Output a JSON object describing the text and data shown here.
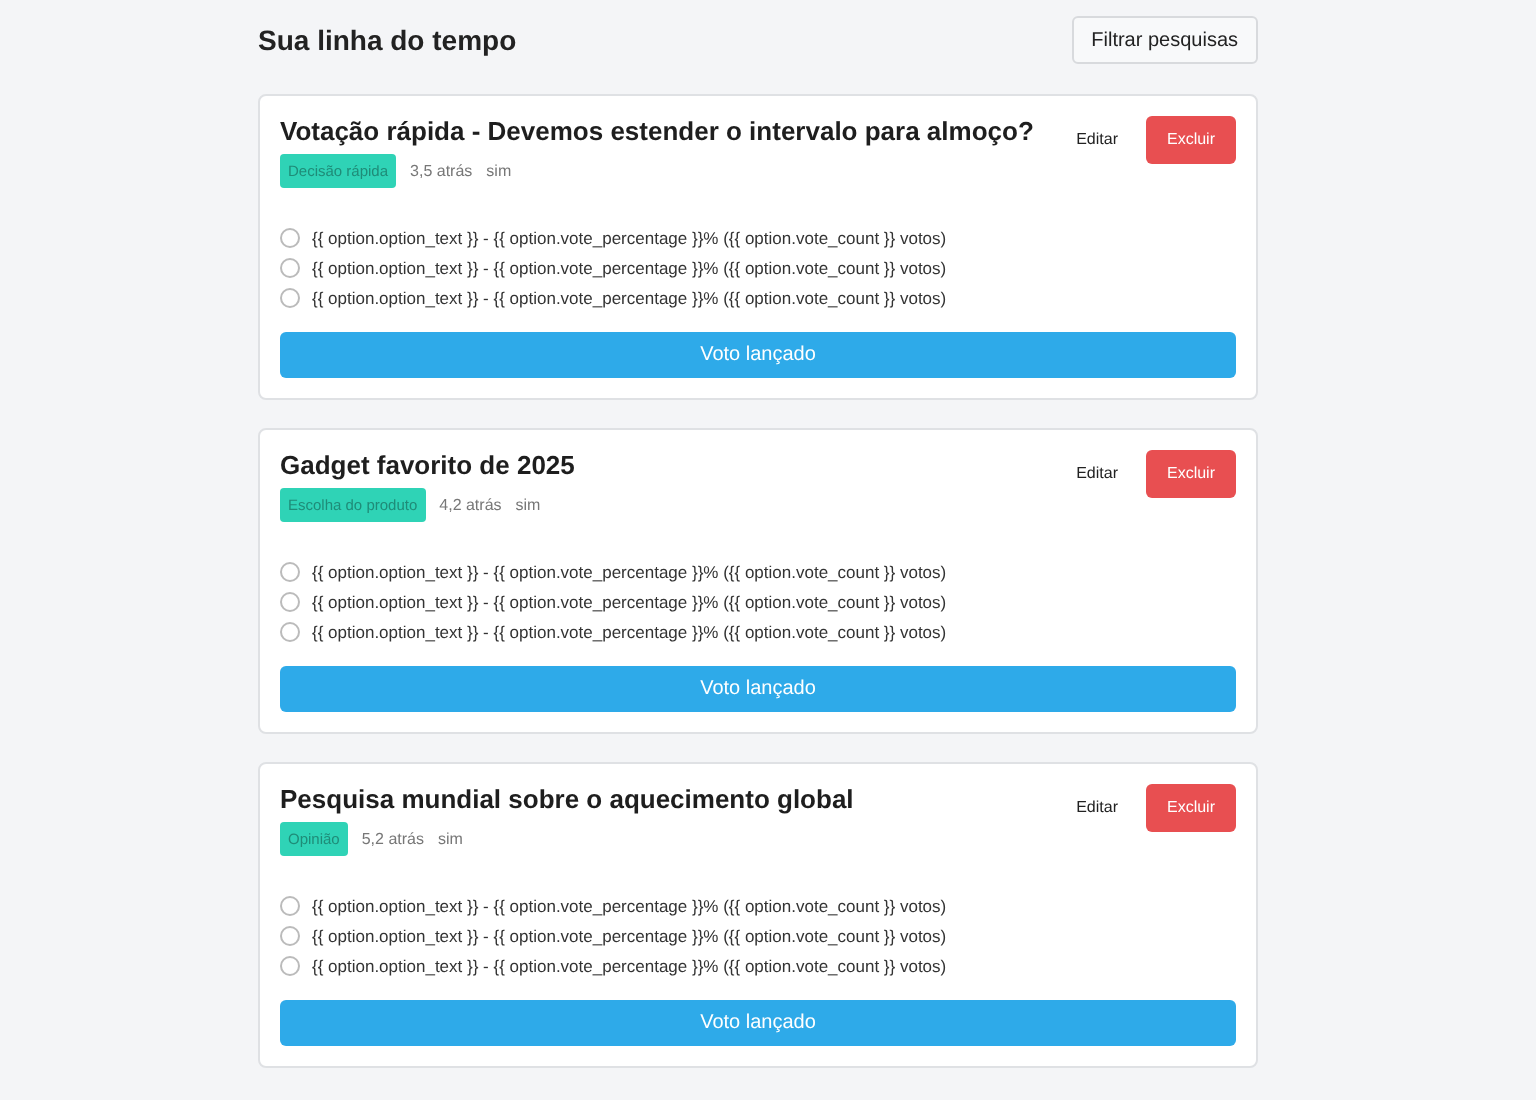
{
  "header": {
    "title": "Sua linha do tempo",
    "filter_button": "Filtrar pesquisas"
  },
  "polls": [
    {
      "title": "Votação rápida - Devemos estender o intervalo para almoço?",
      "tag": "Decisão rápida",
      "time": "3,5 atrás",
      "extra": "sim",
      "edit": "Editar",
      "delete": "Excluir",
      "options": [
        {
          "label": "{{ option.option_text }} - {{ option.vote_percentage }}% ({{ option.vote_count }} votos)",
          "selected": false
        },
        {
          "label": "{{ option.option_text }} - {{ option.vote_percentage }}% ({{ option.vote_count }} votos)",
          "selected": false
        },
        {
          "label": "{{ option.option_text }} - {{ option.vote_percentage }}% ({{ option.vote_count }} votos)",
          "selected": false
        }
      ],
      "vote_button": "Voto lançado"
    },
    {
      "title": "Gadget favorito de 2025",
      "tag": "Escolha do produto",
      "time": "4,2 atrás",
      "extra": "sim",
      "edit": "Editar",
      "delete": "Excluir",
      "options": [
        {
          "label": "{{ option.option_text }} - {{ option.vote_percentage }}% ({{ option.vote_count }} votos)",
          "selected": false
        },
        {
          "label": "{{ option.option_text }} - {{ option.vote_percentage }}% ({{ option.vote_count }} votos)",
          "selected": false
        },
        {
          "label": "{{ option.option_text }} - {{ option.vote_percentage }}% ({{ option.vote_count }} votos)",
          "selected": false
        }
      ],
      "vote_button": "Voto lançado"
    },
    {
      "title": "Pesquisa mundial sobre o aquecimento global",
      "tag": "Opinião",
      "time": "5,2 atrás",
      "extra": "sim",
      "edit": "Editar",
      "delete": "Excluir",
      "options": [
        {
          "label": "{{ option.option_text }} - {{ option.vote_percentage }}% ({{ option.vote_count }} votos)",
          "selected": false
        },
        {
          "label": "{{ option.option_text }} - {{ option.vote_percentage }}% ({{ option.vote_count }} votos)",
          "selected": false
        },
        {
          "label": "{{ option.option_text }} - {{ option.vote_percentage }}% ({{ option.vote_count }} votos)",
          "selected": false
        }
      ],
      "vote_button": "Voto lançado"
    }
  ]
}
